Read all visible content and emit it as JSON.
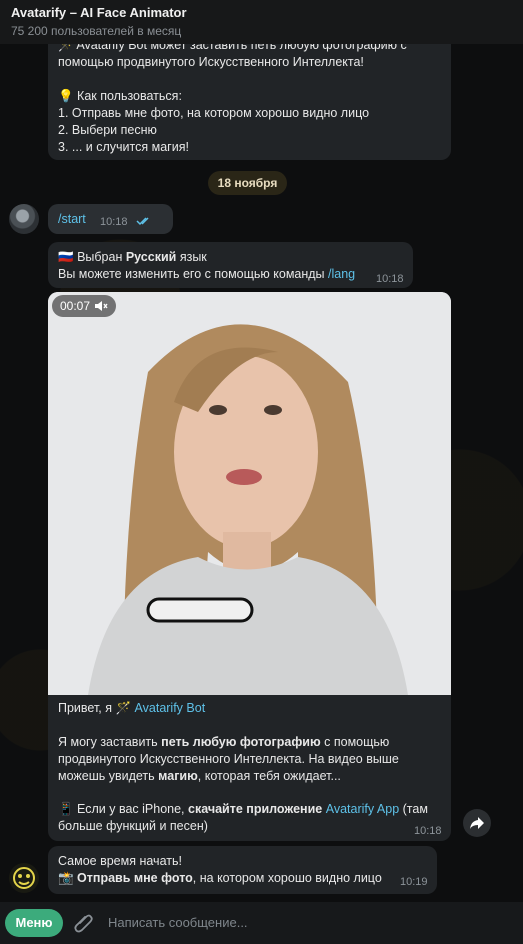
{
  "header": {
    "title": "Avatarify – AI Face Animator",
    "subtitle": "75 200 пользователей в месяц"
  },
  "messages": {
    "first": {
      "line1": "🪄 Avatarify Bot может заставить петь любую фотографию с",
      "line2": "помощью продвинутого Искусственного Интеллекта!",
      "line3": "💡 Как пользоваться:",
      "line4": "1. Отправь мне фото, на котором хорошо видно лицо",
      "line5": "2. Выбери песню",
      "line6": "3. ... и случится магия!"
    },
    "date_label": "18 ноября",
    "start": {
      "text": "/start",
      "time": "10:18"
    },
    "lang": {
      "flag": "🇷🇺",
      "prefix": "Выбран ",
      "language": "Русский",
      "suffix": " язык",
      "line2_text": "Вы можете изменить его с помощью команды ",
      "command": "/lang",
      "time": "10:18"
    },
    "video": {
      "duration": "00:07"
    },
    "greeting": {
      "line1_prefix": "Привет, я 🪄 ",
      "bot_name": "Avatarify Bot",
      "line2_a": "Я могу заставить ",
      "line2_b": "петь любую фотографию",
      "line2_c": " с помощью",
      "line3": "продвинутого Искусственного Интеллекта. На видео выше",
      "line4_a": "можешь увидеть ",
      "line4_b": "магию",
      "line4_c": ", которая тебя ожидает...",
      "line5_a": "📱 Если у вас iPhone, ",
      "line5_b": "скачайте приложение",
      "line5_c": " ",
      "line5_link": "Avatarify App",
      "line5_d": " (там",
      "line6": "больше функций и песен)",
      "time": "10:18"
    },
    "last": {
      "line1": "Самое время начать!",
      "line2_a": "📸 ",
      "line2_b": "Отправь мне фото",
      "line2_c": ", на котором хорошо видно лицо",
      "time": "10:19"
    }
  },
  "composer": {
    "menu_label": "Меню",
    "placeholder": "Написать сообщение..."
  },
  "colors": {
    "accent_green": "#3cab7c",
    "link": "#5ec1e8",
    "bubble": "#212427"
  }
}
